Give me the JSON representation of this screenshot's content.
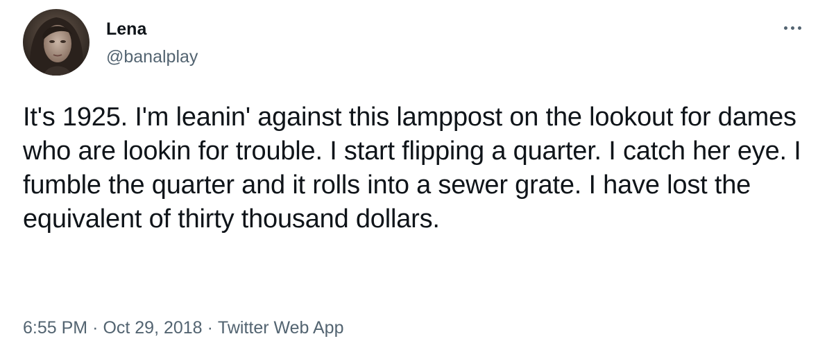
{
  "author": {
    "name": "Lena",
    "handle": "@banalplay",
    "avatar_icon": "profile-photo"
  },
  "more_icon": "more-horizontal-icon",
  "tweet": {
    "text": "It's 1925. I'm leanin' against this lamppost on the lookout for dames who are lookin for trouble. I start flipping a quarter. I catch her eye. I fumble the quarter and it rolls into a sewer grate. I have lost the equivalent of thirty thousand dollars."
  },
  "meta": {
    "time": "6:55 PM",
    "date": "Oct 29, 2018",
    "separator": "·",
    "source": "Twitter Web App"
  },
  "colors": {
    "text_primary": "#0f1419",
    "text_secondary": "#536471",
    "background": "#ffffff"
  }
}
